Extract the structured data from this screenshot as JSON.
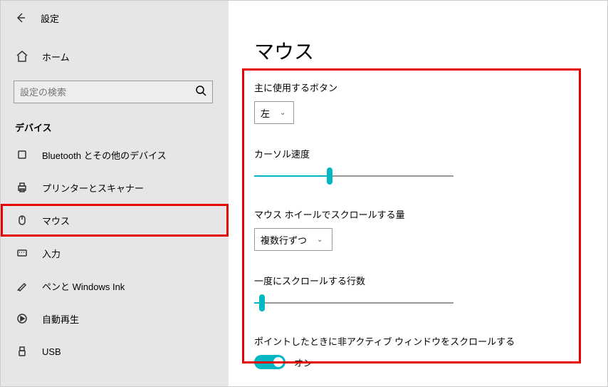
{
  "header": {
    "title": "設定"
  },
  "home_label": "ホーム",
  "search": {
    "placeholder": "設定の検索"
  },
  "section_title": "デバイス",
  "nav": [
    {
      "label": "Bluetooth とその他のデバイス"
    },
    {
      "label": "プリンターとスキャナー"
    },
    {
      "label": "マウス"
    },
    {
      "label": "入力"
    },
    {
      "label": "ペンと Windows Ink"
    },
    {
      "label": "自動再生"
    },
    {
      "label": "USB"
    }
  ],
  "page_title": "マウス",
  "primary_button": {
    "label": "主に使用するボタン",
    "value": "左"
  },
  "cursor_speed": {
    "label": "カーソル速度",
    "value": 38
  },
  "wheel_scroll": {
    "label": "マウス ホイールでスクロールする量",
    "value": "複数行ずつ"
  },
  "lines_at_once": {
    "label": "一度にスクロールする行数",
    "value": 4
  },
  "inactive_scroll": {
    "label": "ポイントしたときに非アクティブ ウィンドウをスクロールする",
    "state": "オン"
  }
}
